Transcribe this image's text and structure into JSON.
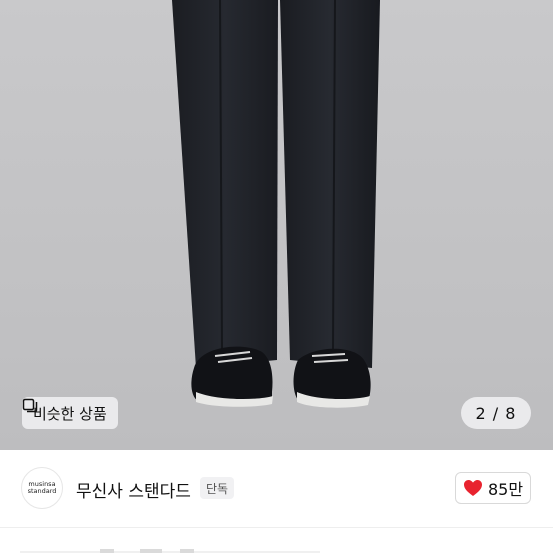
{
  "product_image": {
    "similar_products_label": "비슷한 상품",
    "similar_icon": "similar-items-icon",
    "page_counter": "2 / 8"
  },
  "brand": {
    "logo_lines": [
      "musinsa",
      "standard"
    ],
    "name": "무신사 스탠다드",
    "badge": "단독"
  },
  "likes": {
    "icon": "heart-icon",
    "count": "85만",
    "color": "#e8232f"
  }
}
